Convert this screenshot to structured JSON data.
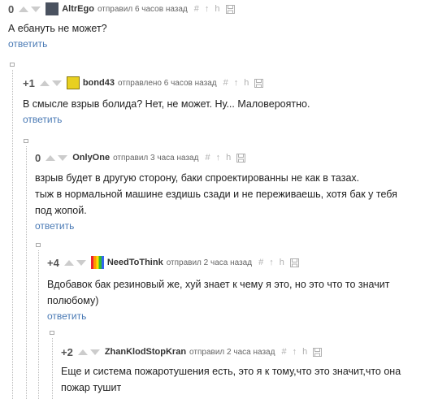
{
  "comments": [
    {
      "rating": "0",
      "username": "AltrEgo",
      "time": "отправил 6 часов назад",
      "text": [
        "А ебануть не может?"
      ],
      "reply": "ответить"
    },
    {
      "rating": "+1",
      "username": "bond43",
      "time": "отправлено 6 часов назад",
      "text": [
        "В смысле взрыв болида? Нет, не может. Ну... Маловероятно."
      ],
      "reply": "ответить"
    },
    {
      "rating": "0",
      "username": "OnlyOne",
      "time": "отправил 3 часа назад",
      "text": [
        "взрыв будет в другую сторону, баки спроектированны не как в тазах.",
        "тыж в нормальной машине ездишь сзади и не переживаешь, хотя бак у тебя",
        "под жопой."
      ],
      "reply": "ответить"
    },
    {
      "rating": "+4",
      "username": "NeedToThink",
      "time": "отправил 2 часа назад",
      "text": [
        "Вдобавок бак резиновый же, хуй знает к чему я это, но это что то значит",
        "полюбому)"
      ],
      "reply": "ответить"
    },
    {
      "rating": "+2",
      "username": "ZhanKlodStopKran",
      "time": "отправил 2 часа назад",
      "text": [
        "Еще и система пожаротушения есть, это я к тому,что это значит,что она",
        "пожар тушит"
      ],
      "reply": ""
    }
  ],
  "tools": {
    "hash": "#",
    "parent": "↑",
    "branch": "h"
  },
  "colors": {
    "link": "#4a7ab5",
    "meta": "#666666",
    "tool": "#b0b0b0"
  }
}
